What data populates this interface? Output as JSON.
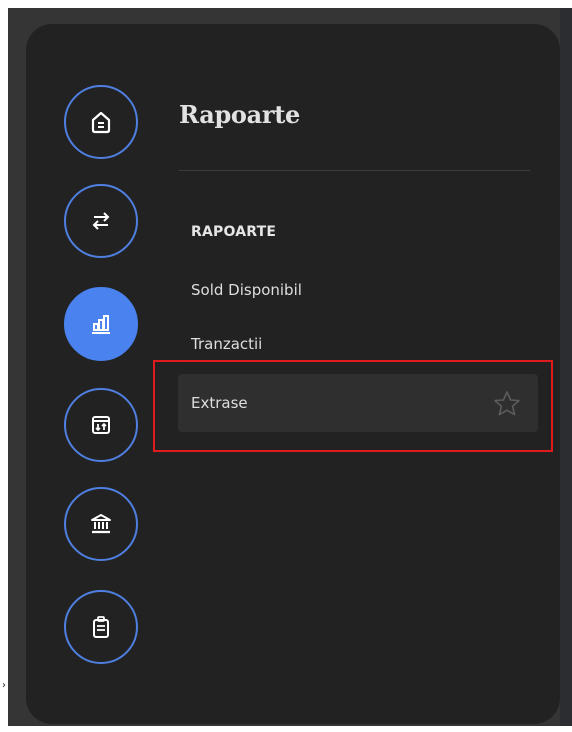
{
  "panel": {
    "title": "Rapoarte"
  },
  "rail": {
    "items": [
      {
        "name": "home",
        "icon": "home-icon",
        "active": false
      },
      {
        "name": "transfers",
        "icon": "transfer-arrows-icon",
        "active": false
      },
      {
        "name": "reports",
        "icon": "bar-chart-icon",
        "active": true
      },
      {
        "name": "exchange",
        "icon": "calendar-exchange-icon",
        "active": false
      },
      {
        "name": "bank",
        "icon": "bank-icon",
        "active": false
      },
      {
        "name": "documents",
        "icon": "clipboard-icon",
        "active": false
      }
    ]
  },
  "menu": {
    "section_heading": "RAPOARTE",
    "items": [
      {
        "label": "Sold Disponibil",
        "selected": false
      },
      {
        "label": "Tranzactii",
        "selected": false
      },
      {
        "label": "Extrase",
        "selected": true,
        "favorite_icon": "star-outline-icon"
      }
    ]
  },
  "colors": {
    "accent": "#4a82ef",
    "panel_bg": "#222222",
    "highlight": "#e01b1b"
  }
}
